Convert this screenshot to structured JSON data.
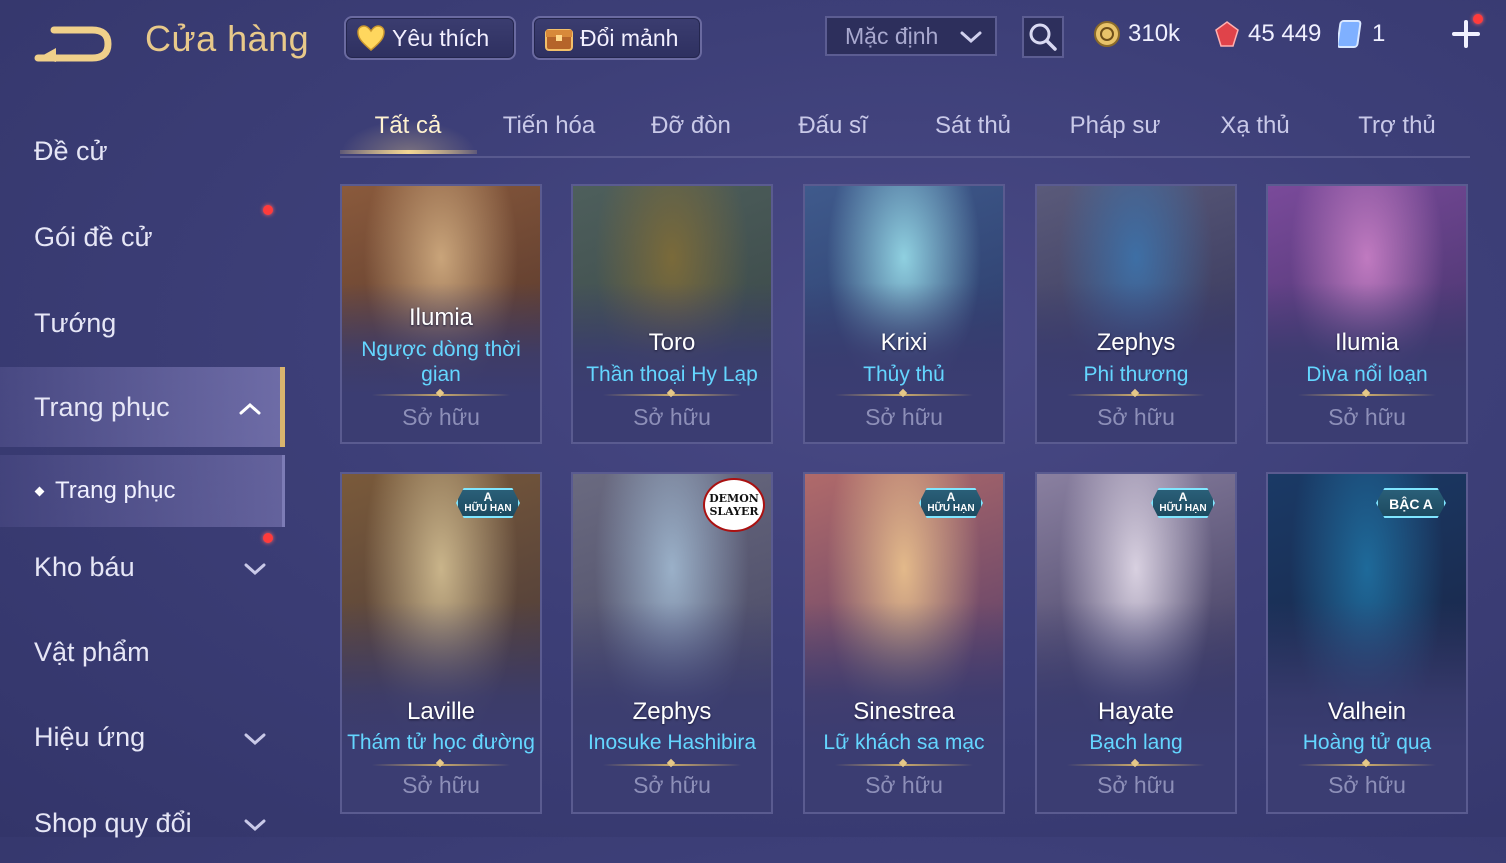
{
  "header": {
    "title": "Cửa hàng",
    "favorite_label": "Yêu thích",
    "exchange_label": "Đổi mảnh",
    "sort_label": "Mặc định",
    "gold": "310k",
    "vouchers": "45 449",
    "cards": "1"
  },
  "sidebar": {
    "items": [
      {
        "label": "Đề cử"
      },
      {
        "label": "Gói đề cử"
      },
      {
        "label": "Tướng"
      },
      {
        "label": "Trang phục"
      },
      {
        "label": "Trang phục"
      },
      {
        "label": "Kho báu"
      },
      {
        "label": "Vật phẩm"
      },
      {
        "label": "Hiệu ứng"
      },
      {
        "label": "Shop quy đổi"
      }
    ]
  },
  "tabs": [
    "Tất cả",
    "Tiến hóa",
    "Đỡ đòn",
    "Đấu sĩ",
    "Sát thủ",
    "Pháp sư",
    "Xạ thủ",
    "Trợ thủ"
  ],
  "cards": [
    {
      "hero": "Ilumia",
      "skin": "Ngược dòng thời gian",
      "status": "Sở hữu",
      "colors": [
        "#c9a47a",
        "#8a5a3c",
        "#5a3a2e"
      ]
    },
    {
      "hero": "Toro",
      "skin": "Thần thoại Hy Lạp",
      "status": "Sở hữu",
      "colors": [
        "#7a6a3a",
        "#4e5f5c",
        "#3c4a4a"
      ]
    },
    {
      "hero": "Krixi",
      "skin": "Thủy thủ",
      "status": "Sở hữu",
      "colors": [
        "#8fd0e0",
        "#3f5a8c",
        "#2e3f6e"
      ]
    },
    {
      "hero": "Zephys",
      "skin": "Phi thương",
      "status": "Sở hữu",
      "colors": [
        "#3e6fa5",
        "#5a5a7a",
        "#3a3a5e"
      ]
    },
    {
      "hero": "Ilumia",
      "skin": "Diva nổi loạn",
      "status": "Sở hữu",
      "colors": [
        "#c07ac0",
        "#7a4a9a",
        "#4a3670"
      ]
    },
    {
      "hero": "Laville",
      "skin": "Thám tử học đường",
      "status": "Sở hữu",
      "badge": "A\nHỮU HẠN",
      "colors": [
        "#c9b48a",
        "#7a5a3a",
        "#4a3a3a"
      ]
    },
    {
      "hero": "Zephys",
      "skin": "Inosuke Hashibira",
      "status": "Sở hữu",
      "badge": "DEMON SLAYER",
      "colors": [
        "#9ab0c8",
        "#6a6a80",
        "#4a4a66"
      ]
    },
    {
      "hero": "Sinestrea",
      "skin": "Lữ khách sa mạc",
      "status": "Sở hữu",
      "badge": "A\nHỮU HẠN",
      "colors": [
        "#e3b98a",
        "#b06a6a",
        "#5a3f6a"
      ]
    },
    {
      "hero": "Hayate",
      "skin": "Bạch lang",
      "status": "Sở hữu",
      "badge": "A\nHỮU HẠN",
      "colors": [
        "#d8d0e0",
        "#8a80a0",
        "#3e3a5e"
      ]
    },
    {
      "hero": "Valhein",
      "skin": "Hoàng tử quạ",
      "status": "Sở hữu",
      "badge": "BẬC A",
      "colors": [
        "#1e6a9a",
        "#1a3a66",
        "#1a2648"
      ]
    }
  ]
}
